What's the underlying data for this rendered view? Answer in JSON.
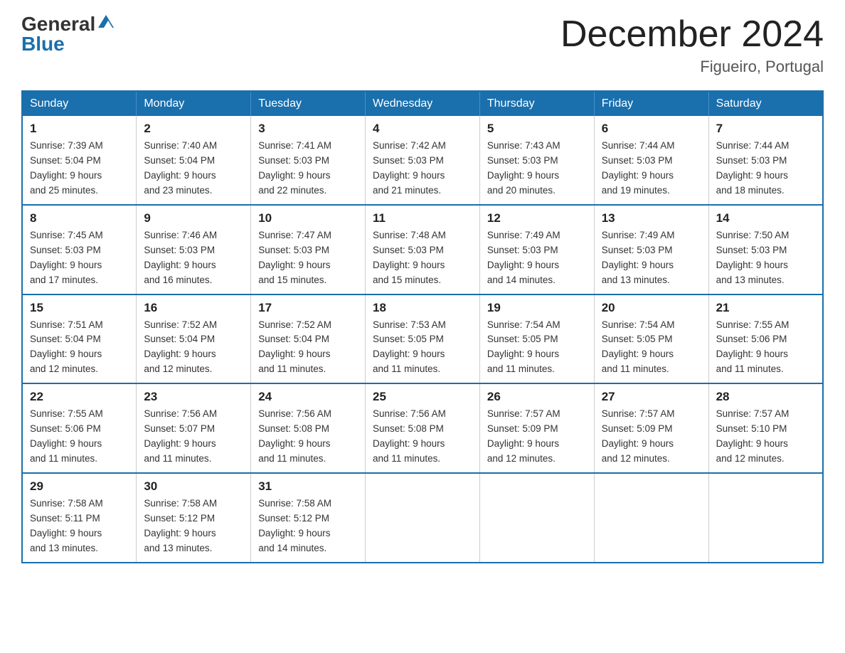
{
  "header": {
    "logo_general": "General",
    "logo_blue": "Blue",
    "month_title": "December 2024",
    "location": "Figueiro, Portugal"
  },
  "weekdays": [
    "Sunday",
    "Monday",
    "Tuesday",
    "Wednesday",
    "Thursday",
    "Friday",
    "Saturday"
  ],
  "weeks": [
    [
      {
        "day": "1",
        "sunrise": "7:39 AM",
        "sunset": "5:04 PM",
        "daylight": "9 hours and 25 minutes."
      },
      {
        "day": "2",
        "sunrise": "7:40 AM",
        "sunset": "5:04 PM",
        "daylight": "9 hours and 23 minutes."
      },
      {
        "day": "3",
        "sunrise": "7:41 AM",
        "sunset": "5:03 PM",
        "daylight": "9 hours and 22 minutes."
      },
      {
        "day": "4",
        "sunrise": "7:42 AM",
        "sunset": "5:03 PM",
        "daylight": "9 hours and 21 minutes."
      },
      {
        "day": "5",
        "sunrise": "7:43 AM",
        "sunset": "5:03 PM",
        "daylight": "9 hours and 20 minutes."
      },
      {
        "day": "6",
        "sunrise": "7:44 AM",
        "sunset": "5:03 PM",
        "daylight": "9 hours and 19 minutes."
      },
      {
        "day": "7",
        "sunrise": "7:44 AM",
        "sunset": "5:03 PM",
        "daylight": "9 hours and 18 minutes."
      }
    ],
    [
      {
        "day": "8",
        "sunrise": "7:45 AM",
        "sunset": "5:03 PM",
        "daylight": "9 hours and 17 minutes."
      },
      {
        "day": "9",
        "sunrise": "7:46 AM",
        "sunset": "5:03 PM",
        "daylight": "9 hours and 16 minutes."
      },
      {
        "day": "10",
        "sunrise": "7:47 AM",
        "sunset": "5:03 PM",
        "daylight": "9 hours and 15 minutes."
      },
      {
        "day": "11",
        "sunrise": "7:48 AM",
        "sunset": "5:03 PM",
        "daylight": "9 hours and 15 minutes."
      },
      {
        "day": "12",
        "sunrise": "7:49 AM",
        "sunset": "5:03 PM",
        "daylight": "9 hours and 14 minutes."
      },
      {
        "day": "13",
        "sunrise": "7:49 AM",
        "sunset": "5:03 PM",
        "daylight": "9 hours and 13 minutes."
      },
      {
        "day": "14",
        "sunrise": "7:50 AM",
        "sunset": "5:03 PM",
        "daylight": "9 hours and 13 minutes."
      }
    ],
    [
      {
        "day": "15",
        "sunrise": "7:51 AM",
        "sunset": "5:04 PM",
        "daylight": "9 hours and 12 minutes."
      },
      {
        "day": "16",
        "sunrise": "7:52 AM",
        "sunset": "5:04 PM",
        "daylight": "9 hours and 12 minutes."
      },
      {
        "day": "17",
        "sunrise": "7:52 AM",
        "sunset": "5:04 PM",
        "daylight": "9 hours and 11 minutes."
      },
      {
        "day": "18",
        "sunrise": "7:53 AM",
        "sunset": "5:05 PM",
        "daylight": "9 hours and 11 minutes."
      },
      {
        "day": "19",
        "sunrise": "7:54 AM",
        "sunset": "5:05 PM",
        "daylight": "9 hours and 11 minutes."
      },
      {
        "day": "20",
        "sunrise": "7:54 AM",
        "sunset": "5:05 PM",
        "daylight": "9 hours and 11 minutes."
      },
      {
        "day": "21",
        "sunrise": "7:55 AM",
        "sunset": "5:06 PM",
        "daylight": "9 hours and 11 minutes."
      }
    ],
    [
      {
        "day": "22",
        "sunrise": "7:55 AM",
        "sunset": "5:06 PM",
        "daylight": "9 hours and 11 minutes."
      },
      {
        "day": "23",
        "sunrise": "7:56 AM",
        "sunset": "5:07 PM",
        "daylight": "9 hours and 11 minutes."
      },
      {
        "day": "24",
        "sunrise": "7:56 AM",
        "sunset": "5:08 PM",
        "daylight": "9 hours and 11 minutes."
      },
      {
        "day": "25",
        "sunrise": "7:56 AM",
        "sunset": "5:08 PM",
        "daylight": "9 hours and 11 minutes."
      },
      {
        "day": "26",
        "sunrise": "7:57 AM",
        "sunset": "5:09 PM",
        "daylight": "9 hours and 12 minutes."
      },
      {
        "day": "27",
        "sunrise": "7:57 AM",
        "sunset": "5:09 PM",
        "daylight": "9 hours and 12 minutes."
      },
      {
        "day": "28",
        "sunrise": "7:57 AM",
        "sunset": "5:10 PM",
        "daylight": "9 hours and 12 minutes."
      }
    ],
    [
      {
        "day": "29",
        "sunrise": "7:58 AM",
        "sunset": "5:11 PM",
        "daylight": "9 hours and 13 minutes."
      },
      {
        "day": "30",
        "sunrise": "7:58 AM",
        "sunset": "5:12 PM",
        "daylight": "9 hours and 13 minutes."
      },
      {
        "day": "31",
        "sunrise": "7:58 AM",
        "sunset": "5:12 PM",
        "daylight": "9 hours and 14 minutes."
      },
      null,
      null,
      null,
      null
    ]
  ],
  "labels": {
    "sunrise": "Sunrise:",
    "sunset": "Sunset:",
    "daylight": "Daylight:"
  }
}
